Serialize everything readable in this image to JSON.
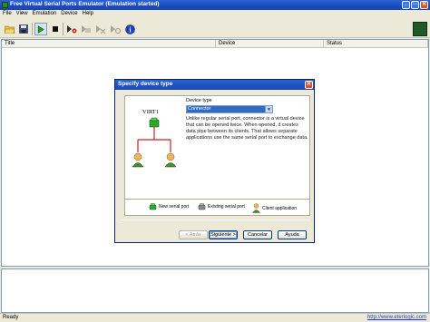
{
  "window": {
    "title": "Free Virtual Serial Ports Emulator (Emulation started)",
    "title_bar_color": "#1b4bbd",
    "close_label": "✕",
    "minimize_label": "_",
    "maximize_label": "□"
  },
  "menu": {
    "items": [
      "File",
      "View",
      "Emulation",
      "Device",
      "Help"
    ]
  },
  "toolbar": {
    "icons": [
      "open-folder-icon",
      "save-icon",
      "play-icon",
      "stop-icon",
      "new-device-icon",
      "device-icon",
      "delete-device-icon",
      "device-properties-icon",
      "info-icon"
    ],
    "info_label": "i"
  },
  "list": {
    "columns": [
      "Title",
      "Device",
      "Status"
    ]
  },
  "status_bar": {
    "text": "Ready",
    "link": "http://www.eterlogic.com"
  },
  "dialog": {
    "title": "Specify device type",
    "diagram_label": "VIRT1",
    "device_type_label": "Device type",
    "device_type_value": "Connector",
    "description": "Unlike regular serial port, connector is a virtual device that can be opened twice. When opened, it creates data pipe between its clients. That allows separate applications use the same serial port to exchange data.",
    "legend": {
      "new_port": "New serial port",
      "existing_port": "Existing serial port",
      "client_app": "Client application"
    },
    "buttons": {
      "back": "< Atrás",
      "next": "Siguiente >",
      "cancel": "Cancelar",
      "help": "Ayuda"
    },
    "colors": {
      "connector_line": "#cc2222",
      "new_port": "#2ea82e",
      "selection": "#316ac5"
    }
  }
}
